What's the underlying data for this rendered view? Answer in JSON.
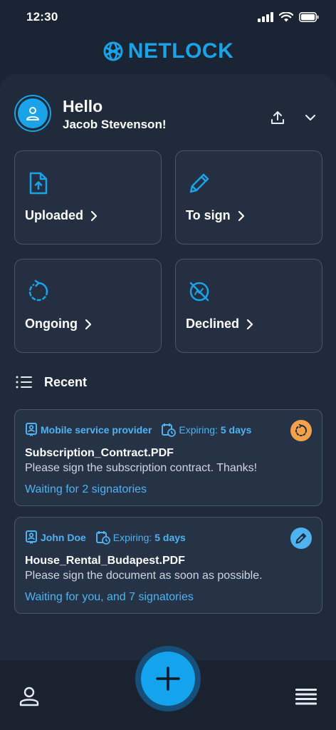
{
  "status_bar": {
    "time": "12:30"
  },
  "brand": {
    "name": "NETLOCK",
    "accent": "#1aa3e8"
  },
  "greeting": {
    "hello": "Hello",
    "user_name": "Jacob Stevenson!"
  },
  "tiles": [
    {
      "label": "Uploaded",
      "icon": "upload-file-icon"
    },
    {
      "label": "To sign",
      "icon": "pencil-icon"
    },
    {
      "label": "Ongoing",
      "icon": "refresh-icon"
    },
    {
      "label": "Declined",
      "icon": "declined-icon"
    }
  ],
  "recent": {
    "title": "Recent",
    "items": [
      {
        "sender": "Mobile service provider",
        "expiring_label": "Expiring:",
        "expiring_value": "5 days",
        "file": "Subscription_Contract.PDF",
        "message": "Please sign the subscription contract. Thanks!",
        "waiting": "Waiting for 2 signatories",
        "status_icon": "ongoing-icon",
        "status_color": "#f5a14a"
      },
      {
        "sender": "John Doe",
        "expiring_label": "Expiring:",
        "expiring_value": "5 days",
        "file": "House_Rental_Budapest.PDF",
        "message": "Please sign the document as soon as possible.",
        "waiting": "Waiting for you, and 7 signatories",
        "status_icon": "pencil-icon",
        "status_color": "#4fb3f0"
      }
    ]
  }
}
